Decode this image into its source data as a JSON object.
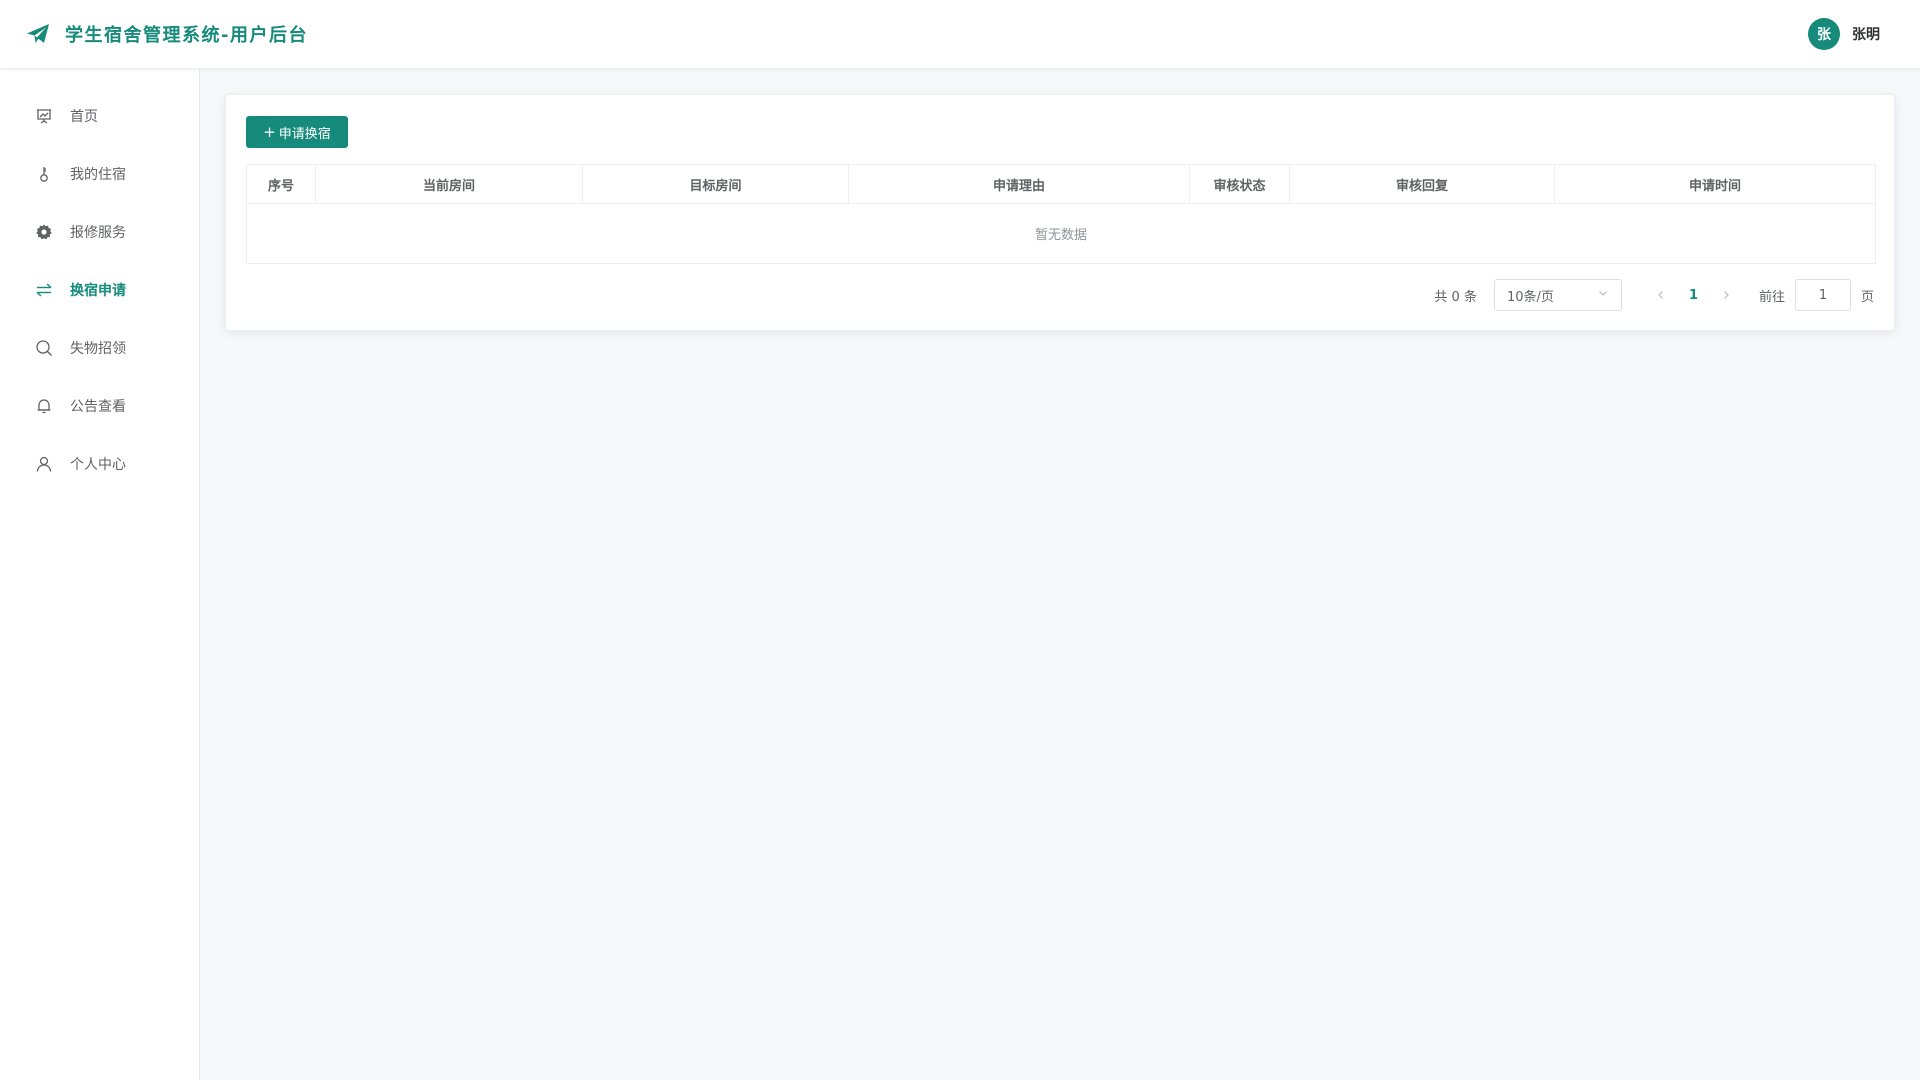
{
  "app": {
    "title": "学生宿舍管理系统-用户后台",
    "accent_color": "#168a7b"
  },
  "user": {
    "avatar_text": "张",
    "name": "张明"
  },
  "sidebar": {
    "items": [
      {
        "label": "首页",
        "icon": "presentation-icon",
        "active": false
      },
      {
        "label": "我的住宿",
        "icon": "key-icon",
        "active": false
      },
      {
        "label": "报修服务",
        "icon": "gear-icon",
        "active": false
      },
      {
        "label": "换宿申请",
        "icon": "swap-icon",
        "active": true
      },
      {
        "label": "失物招领",
        "icon": "search-icon",
        "active": false
      },
      {
        "label": "公告查看",
        "icon": "bell-icon",
        "active": false
      },
      {
        "label": "个人中心",
        "icon": "user-icon",
        "active": false
      }
    ]
  },
  "toolbar": {
    "apply_plus": "+",
    "apply_label": "申请换宿"
  },
  "table": {
    "columns": [
      "序号",
      "当前房间",
      "目标房间",
      "申请理由",
      "审核状态",
      "审核回复",
      "申请时间"
    ],
    "rows": [],
    "empty_text": "暂无数据"
  },
  "pagination": {
    "total_text": "共 0 条",
    "page_size": "10条/页",
    "current_page": "1",
    "goto_label": "前往",
    "goto_value": "1",
    "page_unit": "页"
  }
}
